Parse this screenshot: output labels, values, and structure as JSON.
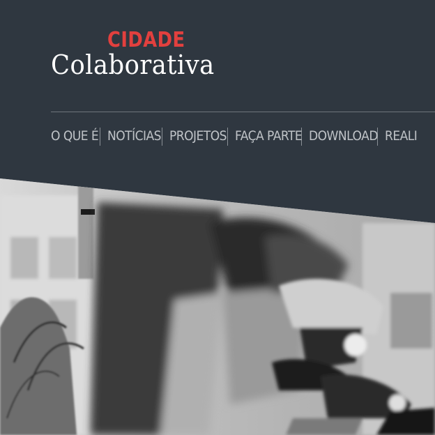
{
  "logo": {
    "line1": "CIDADE",
    "line2": "Colaborativa"
  },
  "nav": {
    "items": [
      {
        "label": "O QUE É"
      },
      {
        "label": "NOTÍCIAS"
      },
      {
        "label": "PROJETOS"
      },
      {
        "label": "FAÇA PARTE"
      },
      {
        "label": "DOWNLOAD"
      },
      {
        "label": "REALI"
      }
    ]
  },
  "colors": {
    "header_bg": "#2f3740",
    "accent_red": "#e2403e",
    "nav_text": "#bfc3c7"
  }
}
